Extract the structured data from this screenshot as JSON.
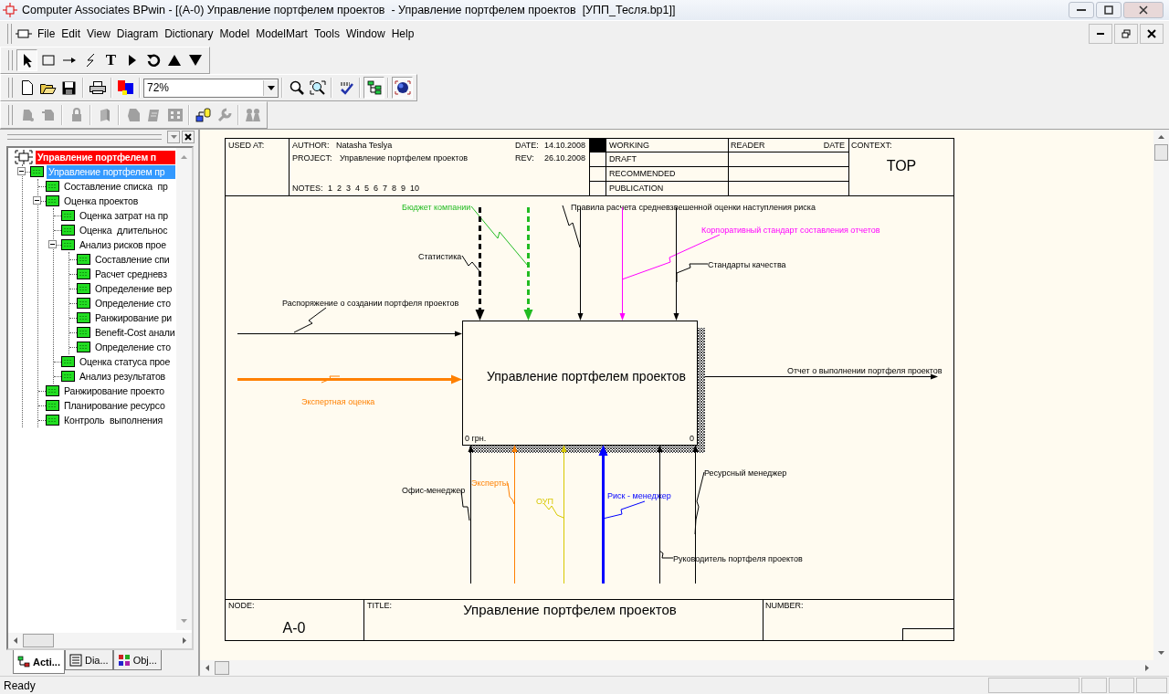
{
  "window": {
    "title": "Computer Associates BPwin - [(A-0) Управление портфелем проектов  - Управление портфелем проектов  [УПП_Тесля.bp1]]"
  },
  "menu": [
    "File",
    "Edit",
    "View",
    "Diagram",
    "Dictionary",
    "Model",
    "ModelMart",
    "Tools",
    "Window",
    "Help"
  ],
  "palette": {
    "text_tool": "T"
  },
  "zoom": "72%",
  "tree": [
    {
      "label": "Управление портфелем п",
      "kind": "context",
      "selected": false,
      "children": [
        {
          "label": "Управление портфелем пр",
          "kind": "activity",
          "selected": true,
          "expanded": true,
          "children": [
            {
              "label": "Составление списка  пр",
              "kind": "activity",
              "selected": false
            },
            {
              "label": "Оценка проектов",
              "kind": "activity",
              "selected": false,
              "expanded": true,
              "children": [
                {
                  "label": "Оценка затрат на пр",
                  "kind": "activity",
                  "selected": false
                },
                {
                  "label": "Оценка  длительнос",
                  "kind": "activity",
                  "selected": false
                },
                {
                  "label": "Анализ рисков прое",
                  "kind": "activity",
                  "selected": false,
                  "expanded": true,
                  "children": [
                    {
                      "label": "Составление спи",
                      "kind": "activity",
                      "selected": false
                    },
                    {
                      "label": "Расчет средневз",
                      "kind": "activity",
                      "selected": false
                    },
                    {
                      "label": "Определение вер",
                      "kind": "activity",
                      "selected": false
                    },
                    {
                      "label": "Определение сто",
                      "kind": "activity",
                      "selected": false
                    },
                    {
                      "label": "Ранжирование ри",
                      "kind": "activity",
                      "selected": false
                    },
                    {
                      "label": "Benefit-Cost анали",
                      "kind": "activity",
                      "selected": false
                    },
                    {
                      "label": "Определение сто",
                      "kind": "activity",
                      "selected": false
                    }
                  ]
                },
                {
                  "label": "Оценка статуса прое",
                  "kind": "activity",
                  "selected": false
                },
                {
                  "label": "Анализ результатов",
                  "kind": "activity",
                  "selected": false
                }
              ]
            },
            {
              "label": "Ранжирование проекто",
              "kind": "activity",
              "selected": false
            },
            {
              "label": "Планирование ресурсо",
              "kind": "activity",
              "selected": false
            },
            {
              "label": "Контроль  выполнения",
              "kind": "activity",
              "selected": false
            }
          ]
        }
      ]
    }
  ],
  "tabs": [
    {
      "label": "Acti...",
      "selected": true
    },
    {
      "label": "Dia...",
      "selected": false
    },
    {
      "label": "Obj...",
      "selected": false
    }
  ],
  "diagram": {
    "header": {
      "used_at_label": "USED AT:",
      "author_label": "AUTHOR:",
      "author": "Natasha Teslya",
      "project_label": "PROJECT:",
      "project": "Управление портфелем проектов",
      "notes_label": "NOTES:",
      "notes": "1  2  3  4  5  6  7  8  9  10",
      "date_label": "DATE:",
      "date": "14.10.2008",
      "rev_label": "REV:",
      "rev": "26.10.2008",
      "reader_label": "READER",
      "reader_date_label": "DATE",
      "context_label": "CONTEXT:",
      "context": "TOP"
    },
    "statuses": [
      {
        "label": "WORKING",
        "selected": true
      },
      {
        "label": "DRAFT",
        "selected": false
      },
      {
        "label": "RECOMMENDED",
        "selected": false
      },
      {
        "label": "PUBLICATION",
        "selected": false
      }
    ],
    "box": {
      "title": "Управление портфелем проектов",
      "cost": "0 грн.",
      "number": "0"
    },
    "arrows": [
      {
        "label": "Бюджет компании",
        "color": "#22bb22",
        "kind": "dashed"
      },
      {
        "label": "Правила расчета средневзвешенной оценки наступления риска",
        "color": "#000000",
        "kind": "thin"
      },
      {
        "label": "Корпоративный стандарт составления отчетов",
        "color": "#ff00ff",
        "kind": "thin"
      },
      {
        "label": "Статистика",
        "color": "#000000",
        "kind": "dashed"
      },
      {
        "label": "Стандарты качества",
        "color": "#000000",
        "kind": "thin"
      },
      {
        "label": "Распоряжение о создании портфеля проектов",
        "color": "#000000",
        "kind": "thin"
      },
      {
        "label": "Отчет о выполнении портфеля проектов",
        "color": "#000000",
        "kind": "thin"
      },
      {
        "label": "Экспертная оценка",
        "color": "#ff8000",
        "kind": "thick"
      },
      {
        "label": "Ресурсный менеджер",
        "color": "#000000",
        "kind": "thin"
      },
      {
        "label": "Эксперты",
        "color": "#ff8000",
        "kind": "thin"
      },
      {
        "label": "Офис-менеджер",
        "color": "#000000",
        "kind": "thin"
      },
      {
        "label": "Риск - менеджер",
        "color": "#0000ff",
        "kind": "thick"
      },
      {
        "label": "ОУП",
        "color": "#d8c800",
        "kind": "thin"
      },
      {
        "label": "Руководитель портфеля проектов",
        "color": "#000000",
        "kind": "thin"
      }
    ],
    "footer": {
      "node_label": "NODE:",
      "node": "A-0",
      "title_label": "TITLE:",
      "title": "Управление портфелем проектов",
      "number_label": "NUMBER:"
    }
  },
  "status_bar": {
    "text": "Ready"
  }
}
